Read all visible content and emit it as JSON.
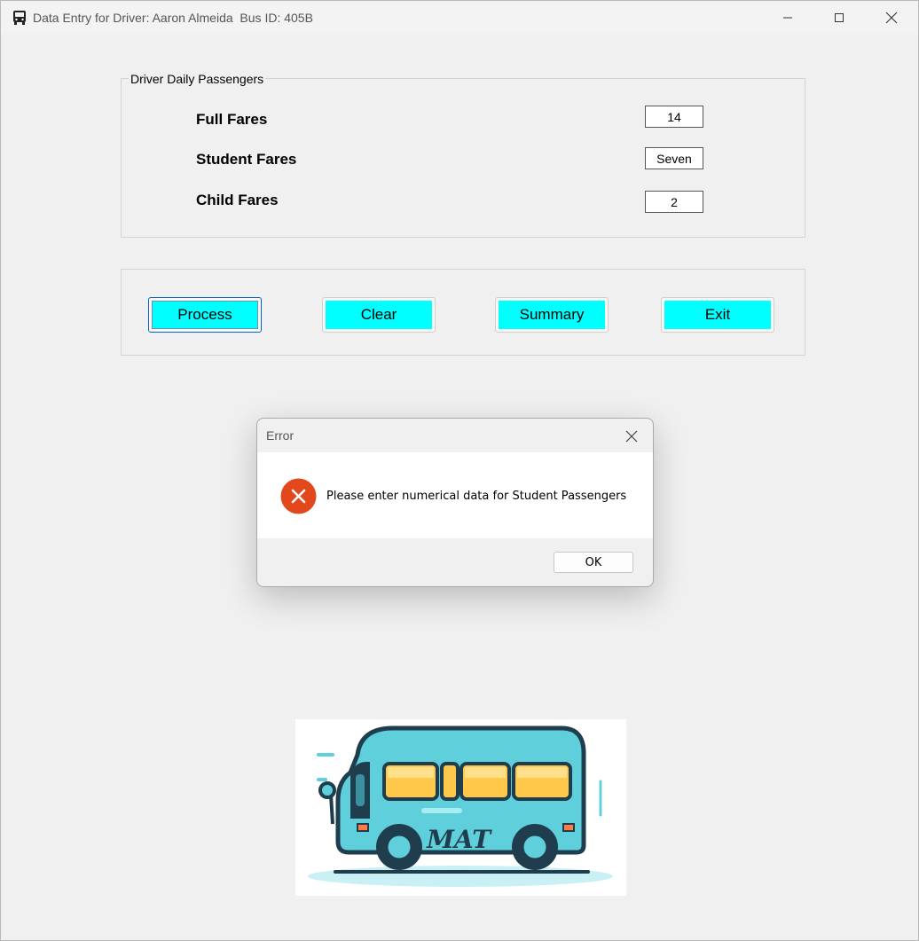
{
  "window": {
    "title": "Data Entry for Driver: Aaron Almeida  Bus ID: 405B"
  },
  "group": {
    "legend": "Driver Daily Passengers",
    "fields": [
      {
        "label": "Full Fares",
        "value": "14"
      },
      {
        "label": "Student Fares",
        "value": "Seven"
      },
      {
        "label": "Child Fares",
        "value": "2"
      }
    ]
  },
  "buttons": {
    "process": "Process",
    "clear": "Clear",
    "summary": "Summary",
    "exit": "Exit"
  },
  "dialog": {
    "title": "Error",
    "message": "Please enter numerical data for Student Passengers",
    "ok": "OK"
  },
  "logo": {
    "text": "MAT"
  },
  "colors": {
    "button_fill": "#00ffff",
    "error_icon": "#e2481b",
    "bus_body": "#5fcfdc",
    "bus_windows": "#ffc84a"
  }
}
